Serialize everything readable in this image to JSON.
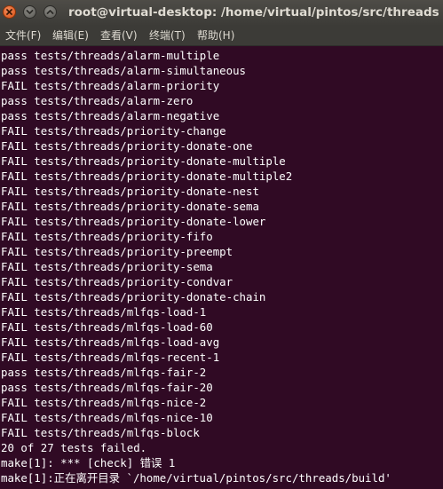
{
  "window": {
    "title": "root@virtual-desktop: /home/virtual/pintos/src/threads"
  },
  "menu": {
    "items": [
      "文件(F)",
      "编辑(E)",
      "查看(V)",
      "终端(T)",
      "帮助(H)"
    ]
  },
  "terminal": {
    "lines": [
      "pass tests/threads/alarm-multiple",
      "pass tests/threads/alarm-simultaneous",
      "FAIL tests/threads/alarm-priority",
      "pass tests/threads/alarm-zero",
      "pass tests/threads/alarm-negative",
      "FAIL tests/threads/priority-change",
      "FAIL tests/threads/priority-donate-one",
      "FAIL tests/threads/priority-donate-multiple",
      "FAIL tests/threads/priority-donate-multiple2",
      "FAIL tests/threads/priority-donate-nest",
      "FAIL tests/threads/priority-donate-sema",
      "FAIL tests/threads/priority-donate-lower",
      "FAIL tests/threads/priority-fifo",
      "FAIL tests/threads/priority-preempt",
      "FAIL tests/threads/priority-sema",
      "FAIL tests/threads/priority-condvar",
      "FAIL tests/threads/priority-donate-chain",
      "FAIL tests/threads/mlfqs-load-1",
      "FAIL tests/threads/mlfqs-load-60",
      "FAIL tests/threads/mlfqs-load-avg",
      "FAIL tests/threads/mlfqs-recent-1",
      "pass tests/threads/mlfqs-fair-2",
      "pass tests/threads/mlfqs-fair-20",
      "FAIL tests/threads/mlfqs-nice-2",
      "FAIL tests/threads/mlfqs-nice-10",
      "FAIL tests/threads/mlfqs-block",
      "20 of 27 tests failed.",
      "make[1]: *** [check] 错误 1",
      "make[1]:正在离开目录 `/home/virtual/pintos/src/threads/build'"
    ]
  },
  "colors": {
    "terminal_bg": "#300a24",
    "terminal_fg": "#ffffff",
    "titlebar_bg": "#3c3b37",
    "close_button": "#e3571c"
  }
}
